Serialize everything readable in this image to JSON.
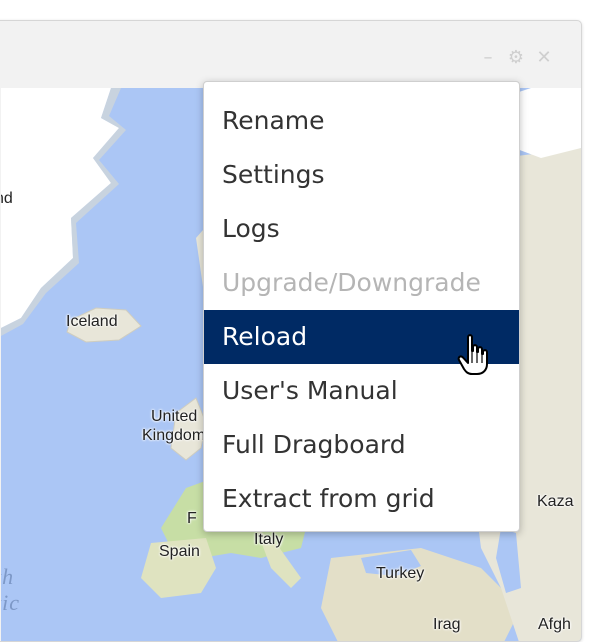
{
  "window": {
    "title_icons": [
      "minimize-icon",
      "gear-icon",
      "close-icon"
    ]
  },
  "map": {
    "labels": [
      "nd",
      "Iceland",
      "United",
      "Kingdom",
      "F",
      "Spain",
      "Italy",
      "Turkey",
      "Kaza",
      "Irag",
      "Afgh"
    ],
    "ocean_label": "th\ntic"
  },
  "menu": {
    "items": [
      {
        "label": "Rename",
        "state": "normal"
      },
      {
        "label": "Settings",
        "state": "normal"
      },
      {
        "label": "Logs",
        "state": "normal"
      },
      {
        "label": "Upgrade/Downgrade",
        "state": "disabled"
      },
      {
        "label": "Reload",
        "state": "highlighted"
      },
      {
        "label": "User's Manual",
        "state": "normal"
      },
      {
        "label": "Full Dragboard",
        "state": "normal"
      },
      {
        "label": "Extract from grid",
        "state": "normal"
      }
    ],
    "highlight_color": "#002a64"
  },
  "colors": {
    "ocean": "#abc6f5",
    "land": "#e8e6d9",
    "ice": "#ffffff",
    "vegetation": "#c7dea5"
  }
}
